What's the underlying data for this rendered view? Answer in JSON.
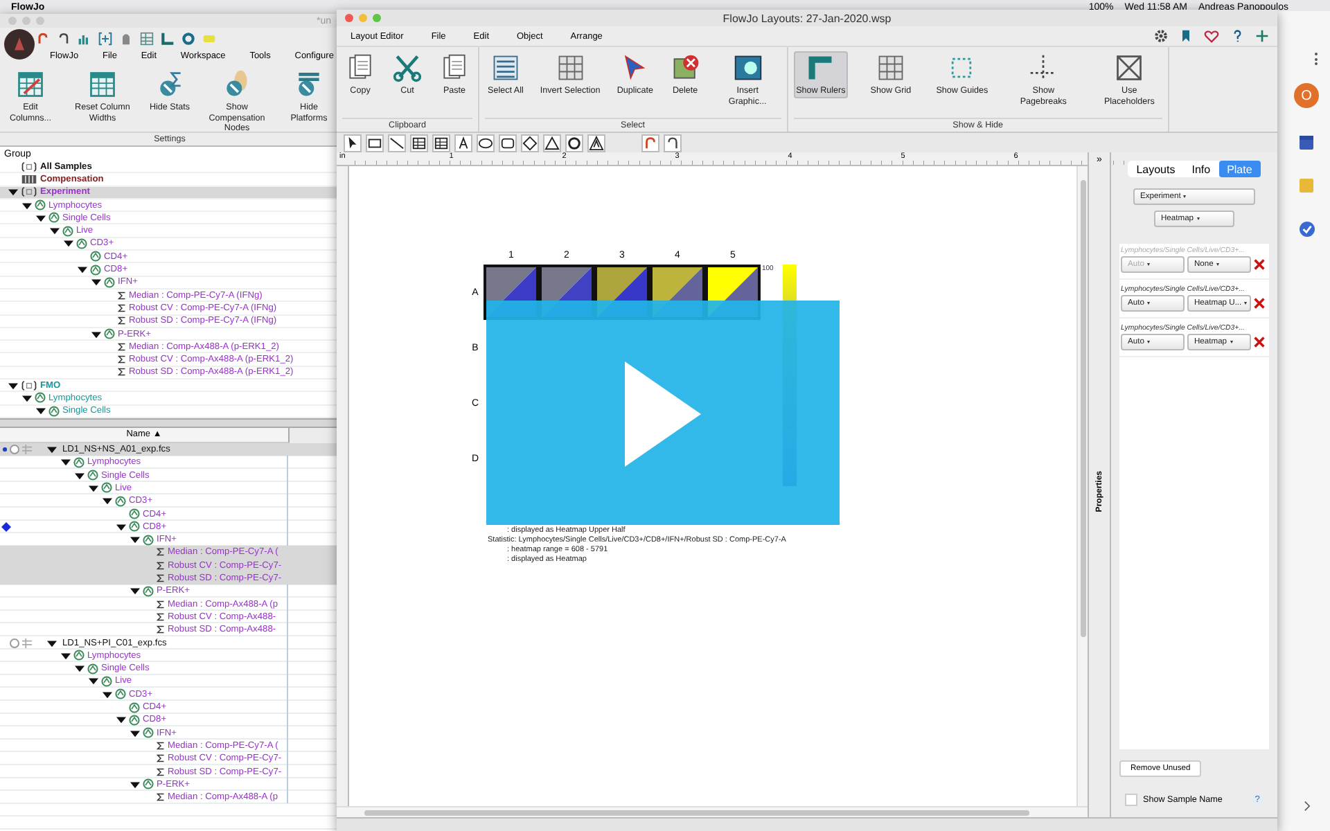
{
  "menubar": {
    "app": "FlowJo",
    "battery": "100%",
    "clock": "Wed 11:58 AM",
    "user": "Andreas Panopoulos"
  },
  "workspace": {
    "title": "*un",
    "menus": [
      "FlowJo",
      "File",
      "Edit",
      "Workspace",
      "Tools",
      "Configure"
    ],
    "ribbon": [
      {
        "label": "Edit Columns..."
      },
      {
        "label": "Reset Column Widths"
      },
      {
        "label": "Hide Stats"
      },
      {
        "label": "Show Compensation Nodes"
      },
      {
        "label": "Hide Platforms"
      }
    ],
    "ribbon_group": "Settings",
    "group_header": "Group",
    "groups": [
      {
        "name": "All Samples",
        "kind": "group",
        "color": "#111111"
      },
      {
        "name": "Compensation",
        "kind": "compensation",
        "color": "#8b1a1a"
      },
      {
        "name": "Experiment",
        "kind": "group",
        "color": "#9b30d0",
        "selected": true,
        "expanded": true,
        "children": [
          {
            "name": "Lymphocytes",
            "kind": "gate",
            "expanded": true,
            "children": [
              {
                "name": "Single Cells",
                "kind": "gate",
                "expanded": true,
                "children": [
                  {
                    "name": "Live",
                    "kind": "gate",
                    "expanded": true,
                    "children": [
                      {
                        "name": "CD3+",
                        "kind": "gate",
                        "expanded": true,
                        "children": [
                          {
                            "name": "CD4+",
                            "kind": "gate"
                          },
                          {
                            "name": "CD8+",
                            "kind": "gate",
                            "expanded": true,
                            "children": [
                              {
                                "name": "IFN+",
                                "kind": "gate",
                                "expanded": true,
                                "children": [
                                  {
                                    "name": "Median : Comp-PE-Cy7-A (IFNg)",
                                    "kind": "stat"
                                  },
                                  {
                                    "name": "Robust CV : Comp-PE-Cy7-A (IFNg)",
                                    "kind": "stat"
                                  },
                                  {
                                    "name": "Robust SD : Comp-PE-Cy7-A (IFNg)",
                                    "kind": "stat"
                                  }
                                ]
                              },
                              {
                                "name": "P-ERK+",
                                "kind": "gate",
                                "expanded": true,
                                "children": [
                                  {
                                    "name": "Median : Comp-Ax488-A (p-ERK1_2)",
                                    "kind": "stat"
                                  },
                                  {
                                    "name": "Robust CV : Comp-Ax488-A (p-ERK1_2)",
                                    "kind": "stat"
                                  },
                                  {
                                    "name": "Robust SD : Comp-Ax488-A (p-ERK1_2)",
                                    "kind": "stat"
                                  }
                                ]
                              }
                            ]
                          }
                        ]
                      }
                    ]
                  }
                ]
              }
            ]
          }
        ]
      },
      {
        "name": "FMO",
        "kind": "group",
        "color": "#119a9a",
        "expanded": true,
        "children": [
          {
            "name": "Lymphocytes",
            "kind": "gate",
            "expanded": true,
            "children": [
              {
                "name": "Single Cells",
                "kind": "gate",
                "expanded": true
              }
            ]
          }
        ]
      }
    ],
    "sample_header": "Name ▲",
    "samples": [
      {
        "name": "LD1_NS+NS_A01_exp.fcs",
        "kind": "sample",
        "selected": true,
        "expanded": true,
        "children": [
          {
            "name": "Lymphocytes",
            "kind": "gate",
            "color": "#9b30d0",
            "expanded": true,
            "children": [
              {
                "name": "Single Cells",
                "kind": "gate",
                "expanded": true,
                "children": [
                  {
                    "name": "Live",
                    "kind": "gate",
                    "expanded": true,
                    "children": [
                      {
                        "name": "CD3+",
                        "kind": "gate",
                        "expanded": true,
                        "children": [
                          {
                            "name": "CD4+",
                            "kind": "gate"
                          },
                          {
                            "name": "CD8+",
                            "kind": "gate",
                            "flagged": true,
                            "expanded": true,
                            "children": [
                              {
                                "name": "IFN+",
                                "kind": "gate",
                                "expanded": true,
                                "children": [
                                  {
                                    "name": "Median : Comp-PE-Cy7-A (",
                                    "kind": "stat",
                                    "selected": true
                                  },
                                  {
                                    "name": "Robust CV : Comp-PE-Cy7-",
                                    "kind": "stat",
                                    "selected": true
                                  },
                                  {
                                    "name": "Robust SD : Comp-PE-Cy7-",
                                    "kind": "stat",
                                    "selected": true
                                  }
                                ]
                              },
                              {
                                "name": "P-ERK+",
                                "kind": "gate",
                                "expanded": true,
                                "children": [
                                  {
                                    "name": "Median : Comp-Ax488-A (p",
                                    "kind": "stat"
                                  },
                                  {
                                    "name": "Robust CV : Comp-Ax488-",
                                    "kind": "stat"
                                  },
                                  {
                                    "name": "Robust SD : Comp-Ax488-",
                                    "kind": "stat"
                                  }
                                ]
                              }
                            ]
                          }
                        ]
                      }
                    ]
                  }
                ]
              }
            ]
          }
        ]
      },
      {
        "name": "LD1_NS+PI_C01_exp.fcs",
        "kind": "sample",
        "selected": false,
        "expanded": true,
        "children": [
          {
            "name": "Lymphocytes",
            "kind": "gate",
            "color": "#9b30d0",
            "expanded": true,
            "children": [
              {
                "name": "Single Cells",
                "kind": "gate",
                "expanded": true,
                "children": [
                  {
                    "name": "Live",
                    "kind": "gate",
                    "expanded": true,
                    "children": [
                      {
                        "name": "CD3+",
                        "kind": "gate",
                        "expanded": true,
                        "children": [
                          {
                            "name": "CD4+",
                            "kind": "gate"
                          },
                          {
                            "name": "CD8+",
                            "kind": "gate",
                            "expanded": true,
                            "children": [
                              {
                                "name": "IFN+",
                                "kind": "gate",
                                "expanded": true,
                                "children": [
                                  {
                                    "name": "Median : Comp-PE-Cy7-A (",
                                    "kind": "stat"
                                  },
                                  {
                                    "name": "Robust CV : Comp-PE-Cy7-",
                                    "kind": "stat"
                                  },
                                  {
                                    "name": "Robust SD : Comp-PE-Cy7-",
                                    "kind": "stat"
                                  }
                                ]
                              },
                              {
                                "name": "P-ERK+",
                                "kind": "gate",
                                "expanded": true,
                                "children": [
                                  {
                                    "name": "Median : Comp-Ax488-A (p",
                                    "kind": "stat"
                                  }
                                ]
                              }
                            ]
                          }
                        ]
                      }
                    ]
                  }
                ]
              }
            ]
          }
        ]
      }
    ]
  },
  "layout_editor": {
    "title": "FlowJo Layouts: 27-Jan-2020.wsp",
    "menus": [
      "Layout Editor",
      "File",
      "Edit",
      "Object",
      "Arrange"
    ],
    "ribbon_groups": [
      {
        "name": "Clipboard",
        "buttons": [
          {
            "label": "Copy",
            "selected": false
          },
          {
            "label": "Cut",
            "selected": false
          },
          {
            "label": "Paste",
            "selected": false
          }
        ]
      },
      {
        "name": "Select",
        "buttons": [
          {
            "label": "Select All",
            "selected": false
          },
          {
            "label": "Invert Selection",
            "selected": false
          },
          {
            "label": "Duplicate",
            "selected": false
          },
          {
            "label": "Delete",
            "selected": false
          },
          {
            "label": "Insert Graphic...",
            "selected": false
          }
        ]
      },
      {
        "name": "Show & Hide",
        "buttons": [
          {
            "label": "Show Rulers",
            "selected": true
          },
          {
            "label": "Show Grid",
            "selected": false
          },
          {
            "label": "Show Guides",
            "selected": false
          },
          {
            "label": "Show Pagebreaks",
            "selected": false
          },
          {
            "label": "Use Placeholders",
            "selected": false
          }
        ]
      }
    ],
    "ruler": {
      "unit": "in",
      "marks": [
        "1",
        "2",
        "3",
        "4",
        "5",
        "6"
      ]
    },
    "plate": {
      "columns": [
        "1",
        "2",
        "3",
        "4",
        "5"
      ],
      "rows": [
        {
          "label": "A",
          "wells": [
            {
              "halves": [
                {
                  "color": "#78788c"
                },
                {
                  "color": "#3b3bc8"
                }
              ]
            },
            {
              "halves": [
                {
                  "color": "#78788c"
                },
                {
                  "color": "#4141c4"
                }
              ]
            },
            {
              "halves": [
                {
                  "color": "#aea43e"
                },
                {
                  "color": "#3838c8"
                }
              ]
            },
            {
              "halves": [
                {
                  "color": "#bdb43c"
                },
                {
                  "color": "#64649a"
                }
              ]
            },
            {
              "halves": [
                {
                  "color": "#ffff00"
                },
                {
                  "color": "#64649a"
                }
              ]
            }
          ]
        },
        {
          "label": "B"
        },
        {
          "label": "C"
        },
        {
          "label": "D"
        }
      ]
    },
    "legend": {
      "top_label": "100"
    },
    "notes": [
      {
        "kind": "detail",
        "text": ": displayed as Heatmap Upper Half"
      },
      {
        "kind": "statistic",
        "text": "Statistic: Lymphocytes/Single Cells/Live/CD3+/CD8+/IFN+/Robust SD : Comp-PE-Cy7-A"
      },
      {
        "kind": "detail",
        "text": ": heatmap range = 608 - 5791"
      },
      {
        "kind": "detail",
        "text": ": displayed as Heatmap"
      }
    ],
    "collapse": "»",
    "properties_tab": "Properties",
    "panel": {
      "tabs": [
        {
          "label": "Layouts",
          "selected": false
        },
        {
          "label": "Info",
          "selected": false
        },
        {
          "label": "Plate",
          "selected": true
        }
      ],
      "group_dropdown": "Experiment",
      "display_dropdown": "Heatmap",
      "parameters": [
        {
          "path": "Lymphocytes/Single Cells/Live/CD3+...",
          "disabled": true,
          "scale": "Auto",
          "display": "None"
        },
        {
          "path": "Lymphocytes/Single Cells/Live/CD3+...",
          "disabled": false,
          "scale": "Auto",
          "display": "Heatmap U..."
        },
        {
          "path": "Lymphocytes/Single Cells/Live/CD3+...",
          "disabled": false,
          "scale": "Auto",
          "display": "Heatmap"
        }
      ],
      "remove_button": "Remove Unused",
      "show_sample_name": {
        "label": "Show Sample Name",
        "checked": false
      },
      "help": "?"
    }
  },
  "browser": {
    "avatar": "O"
  }
}
